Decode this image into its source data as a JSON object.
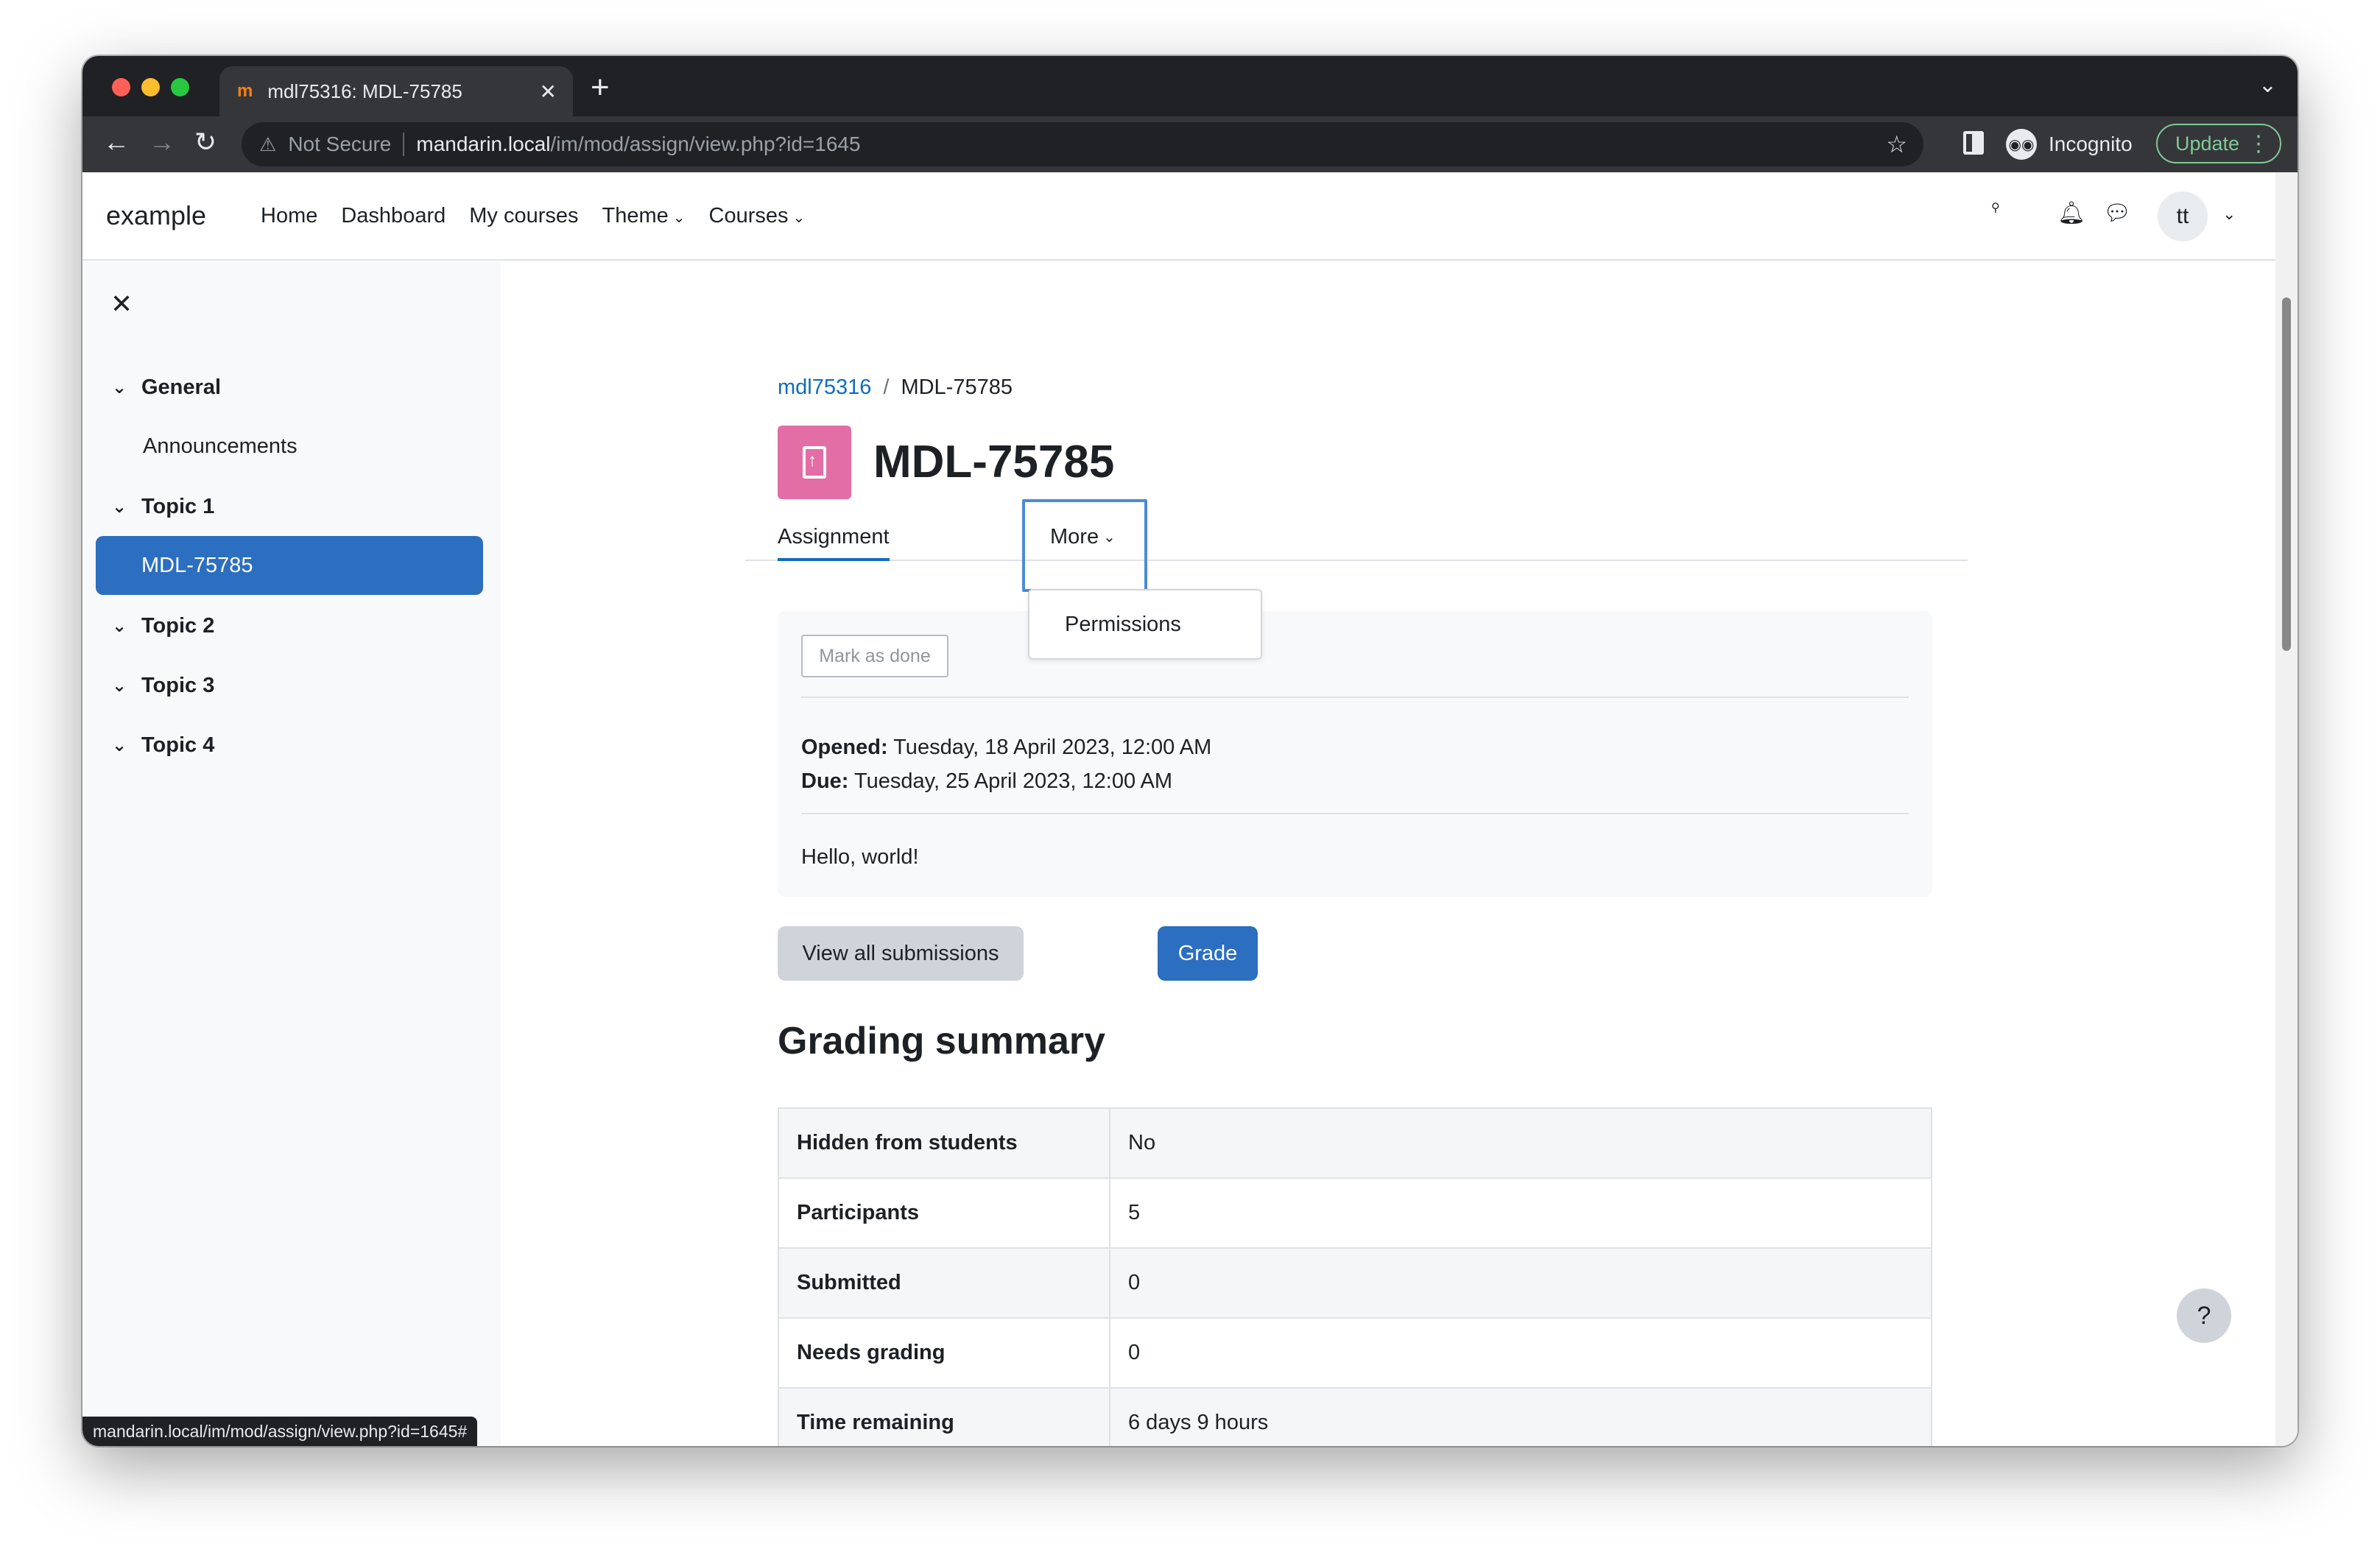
{
  "browser": {
    "tab_title": "mdl75316: MDL-75785",
    "tab_favicon": "m",
    "security_label": "Not Secure",
    "url_host": "mandarin.local",
    "url_path": "/im/mod/assign/view.php?id=1645",
    "profile_label": "Incognito",
    "update_label": "Update",
    "status_url": "mandarin.local/im/mod/assign/view.php?id=1645#"
  },
  "navbar": {
    "brand": "example",
    "items": [
      {
        "label": "Home"
      },
      {
        "label": "Dashboard"
      },
      {
        "label": "My courses"
      },
      {
        "label": "Theme"
      },
      {
        "label": "Courses"
      }
    ],
    "avatar_initials": "tt"
  },
  "drawer": {
    "items": [
      {
        "label": "General"
      },
      {
        "label": "Announcements"
      },
      {
        "label": "Topic 1"
      },
      {
        "label": "MDL-75785"
      },
      {
        "label": "Topic 2"
      },
      {
        "label": "Topic 3"
      },
      {
        "label": "Topic 4"
      }
    ]
  },
  "breadcrumb": {
    "course": "mdl75316",
    "separator": "/",
    "current": "MDL-75785"
  },
  "page": {
    "title": "MDL-75785",
    "icon_color": "#e36da5"
  },
  "secondary_nav": {
    "tabs": [
      {
        "label": "Assignment"
      },
      {
        "label": "More"
      }
    ],
    "dropdown_items": [
      {
        "label": "Permissions"
      }
    ]
  },
  "activity": {
    "mark_done_label": "Mark as done",
    "opened_label": "Opened:",
    "opened_value": "Tuesday, 18 April 2023, 12:00 AM",
    "due_label": "Due:",
    "due_value": "Tuesday, 25 April 2023, 12:00 AM",
    "intro": "Hello, world!"
  },
  "actions": {
    "view_all_label": "View all submissions",
    "grade_label": "Grade"
  },
  "grading_summary": {
    "heading": "Grading summary",
    "rows": [
      {
        "label": "Hidden from students",
        "value": "No"
      },
      {
        "label": "Participants",
        "value": "5"
      },
      {
        "label": "Submitted",
        "value": "0"
      },
      {
        "label": "Needs grading",
        "value": "0"
      },
      {
        "label": "Time remaining",
        "value": "6 days 9 hours"
      }
    ]
  },
  "help_label": "?",
  "colors": {
    "primary": "#0f6cbf",
    "active_item": "#2c6ebf",
    "secondary_button": "#ced4da"
  }
}
